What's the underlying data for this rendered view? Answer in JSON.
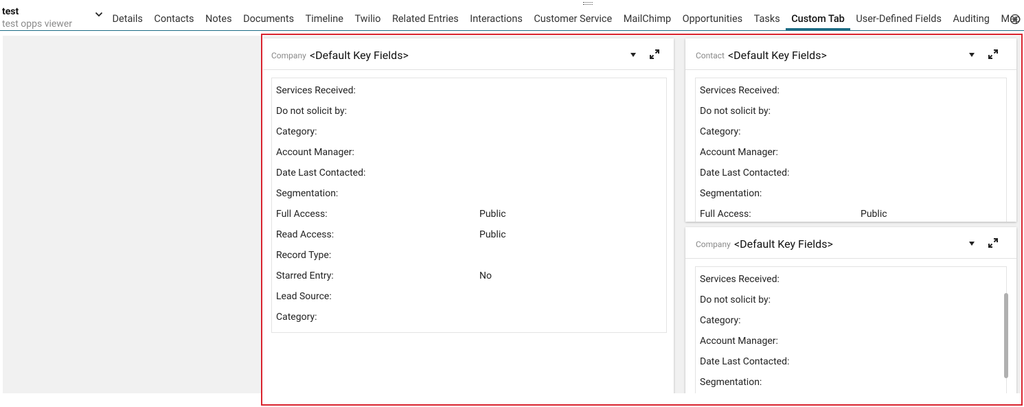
{
  "header": {
    "title": "test",
    "subtitle": "test opps viewer",
    "tabs": [
      {
        "label": "Details"
      },
      {
        "label": "Contacts"
      },
      {
        "label": "Notes"
      },
      {
        "label": "Documents"
      },
      {
        "label": "Timeline"
      },
      {
        "label": "Twilio"
      },
      {
        "label": "Related Entries"
      },
      {
        "label": "Interactions"
      },
      {
        "label": "Customer Service"
      },
      {
        "label": "MailChimp"
      },
      {
        "label": "Opportunities"
      },
      {
        "label": "Tasks"
      },
      {
        "label": "Custom Tab"
      },
      {
        "label": "User-Defined Fields"
      },
      {
        "label": "Auditing"
      },
      {
        "label": "Map"
      }
    ],
    "active_tab": "Custom Tab",
    "accent_color": "#1b6b84"
  },
  "panels": [
    {
      "kind": "Company",
      "name": "<Default Key Fields>",
      "fields": [
        {
          "label": "Services Received:",
          "value": ""
        },
        {
          "label": "Do not solicit by:",
          "value": ""
        },
        {
          "label": "Category:",
          "value": ""
        },
        {
          "label": "Account Manager:",
          "value": ""
        },
        {
          "label": "Date Last Contacted:",
          "value": ""
        },
        {
          "label": "Segmentation:",
          "value": ""
        },
        {
          "label": "Full Access:",
          "value": "Public"
        },
        {
          "label": "Read Access:",
          "value": "Public"
        },
        {
          "label": "Record Type:",
          "value": ""
        },
        {
          "label": "Starred Entry:",
          "value": "No"
        },
        {
          "label": "Lead Source:",
          "value": ""
        },
        {
          "label": "Category:",
          "value": ""
        }
      ]
    },
    {
      "kind": "Contact",
      "name": "<Default Key Fields>",
      "fields": [
        {
          "label": "Services Received:",
          "value": ""
        },
        {
          "label": "Do not solicit by:",
          "value": ""
        },
        {
          "label": "Category:",
          "value": ""
        },
        {
          "label": "Account Manager:",
          "value": ""
        },
        {
          "label": "Date Last Contacted:",
          "value": ""
        },
        {
          "label": "Segmentation:",
          "value": ""
        },
        {
          "label": "Full Access:",
          "value": "Public"
        }
      ]
    },
    {
      "kind": "Company",
      "name": "<Default Key Fields>",
      "fields": [
        {
          "label": "Services Received:",
          "value": ""
        },
        {
          "label": "Do not solicit by:",
          "value": ""
        },
        {
          "label": "Category:",
          "value": ""
        },
        {
          "label": "Account Manager:",
          "value": ""
        },
        {
          "label": "Date Last Contacted:",
          "value": ""
        },
        {
          "label": "Segmentation:",
          "value": ""
        }
      ]
    }
  ],
  "colors": {
    "selection_frame": "#d9232e",
    "workspace_bg": "#f1f1f1"
  }
}
